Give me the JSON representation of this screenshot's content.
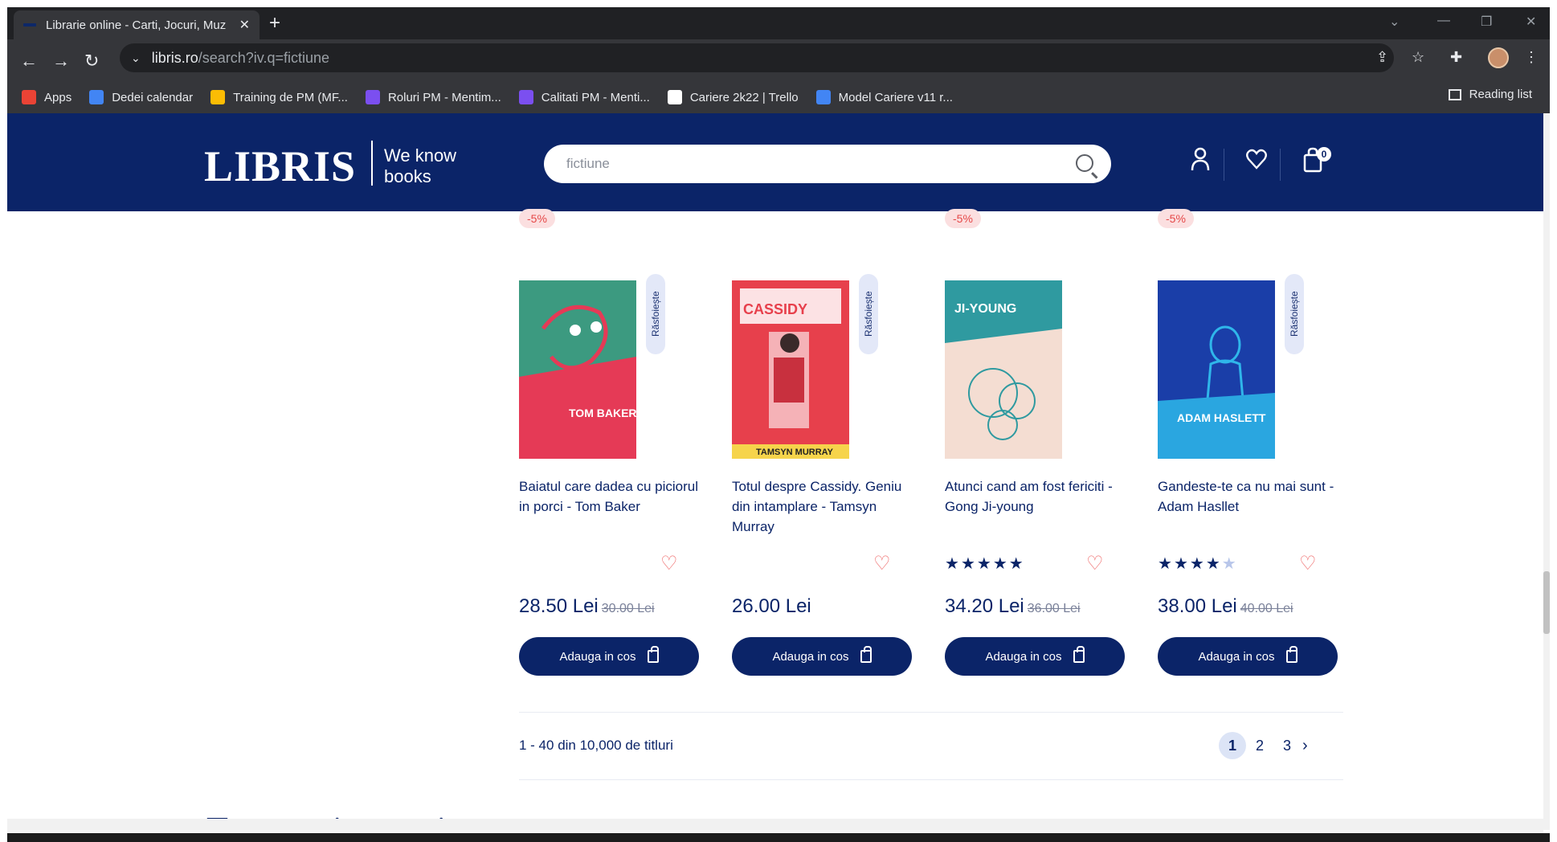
{
  "browser": {
    "tab_title": "Librarie online - Carti, Jocuri, Muz",
    "url_host": "libris.ro",
    "url_path": "/search?iv.q=fictiune",
    "bookmarks": [
      {
        "label": "Apps",
        "color": "#ea4335"
      },
      {
        "label": "Dedei calendar",
        "color": "#4285f4"
      },
      {
        "label": "Training de PM (MF...",
        "color": "#fbbc04"
      },
      {
        "label": "Roluri PM - Mentim...",
        "color": "#7b4ff0"
      },
      {
        "label": "Calitati PM - Menti...",
        "color": "#7b4ff0"
      },
      {
        "label": "Cariere 2k22 | Trello",
        "color": "#ffffff"
      },
      {
        "label": "Model Cariere v11 r...",
        "color": "#4285f4"
      }
    ],
    "reading_list": "Reading list"
  },
  "header": {
    "logo": "LIBRIS",
    "tagline_line1": "We know",
    "tagline_line2": "books",
    "search_value": "fictiune",
    "cart_count": "0"
  },
  "products": [
    {
      "discount": "-5%",
      "peek": "Răsfoiește",
      "title": "Baiatul care dadea cu piciorul in porci - Tom Baker",
      "price": "28.50 Lei",
      "old_price": "30.00 Lei",
      "rating": 0,
      "button": "Adauga in cos",
      "cover_author": "TOM BAKER",
      "cover_color": "#3c9a80"
    },
    {
      "discount": "",
      "peek": "Răsfoiește",
      "title": "Totul despre Cassidy. Geniu din intamplare - Tamsyn Murray",
      "price": "26.00 Lei",
      "old_price": "",
      "rating": 0,
      "button": "Adauga in cos",
      "cover_author": "TAMSYN MURRAY",
      "cover_color": "#e7404c"
    },
    {
      "discount": "-5%",
      "peek": "",
      "title": "Atunci cand am fost fericiti - Gong Ji-young",
      "price": "34.20 Lei",
      "old_price": "36.00 Lei",
      "rating": 5,
      "button": "Adauga in cos",
      "cover_author": "GONG JI-YOUNG",
      "cover_color": "#f4ddd2"
    },
    {
      "discount": "-5%",
      "peek": "Răsfoiește",
      "title": "Gandeste-te ca nu mai sunt - Adam Hasllet",
      "price": "38.00 Lei",
      "old_price": "40.00 Lei",
      "rating": 4,
      "button": "Adauga in cos",
      "cover_author": "ADAM HASLETT",
      "cover_color": "#1a3ea8"
    }
  ],
  "results_text": "1 - 40 din 10,000 de titluri",
  "pagination": [
    "1",
    "2",
    "3"
  ],
  "next_label": "›",
  "section_peek": "Te-ar mai putea interesa"
}
